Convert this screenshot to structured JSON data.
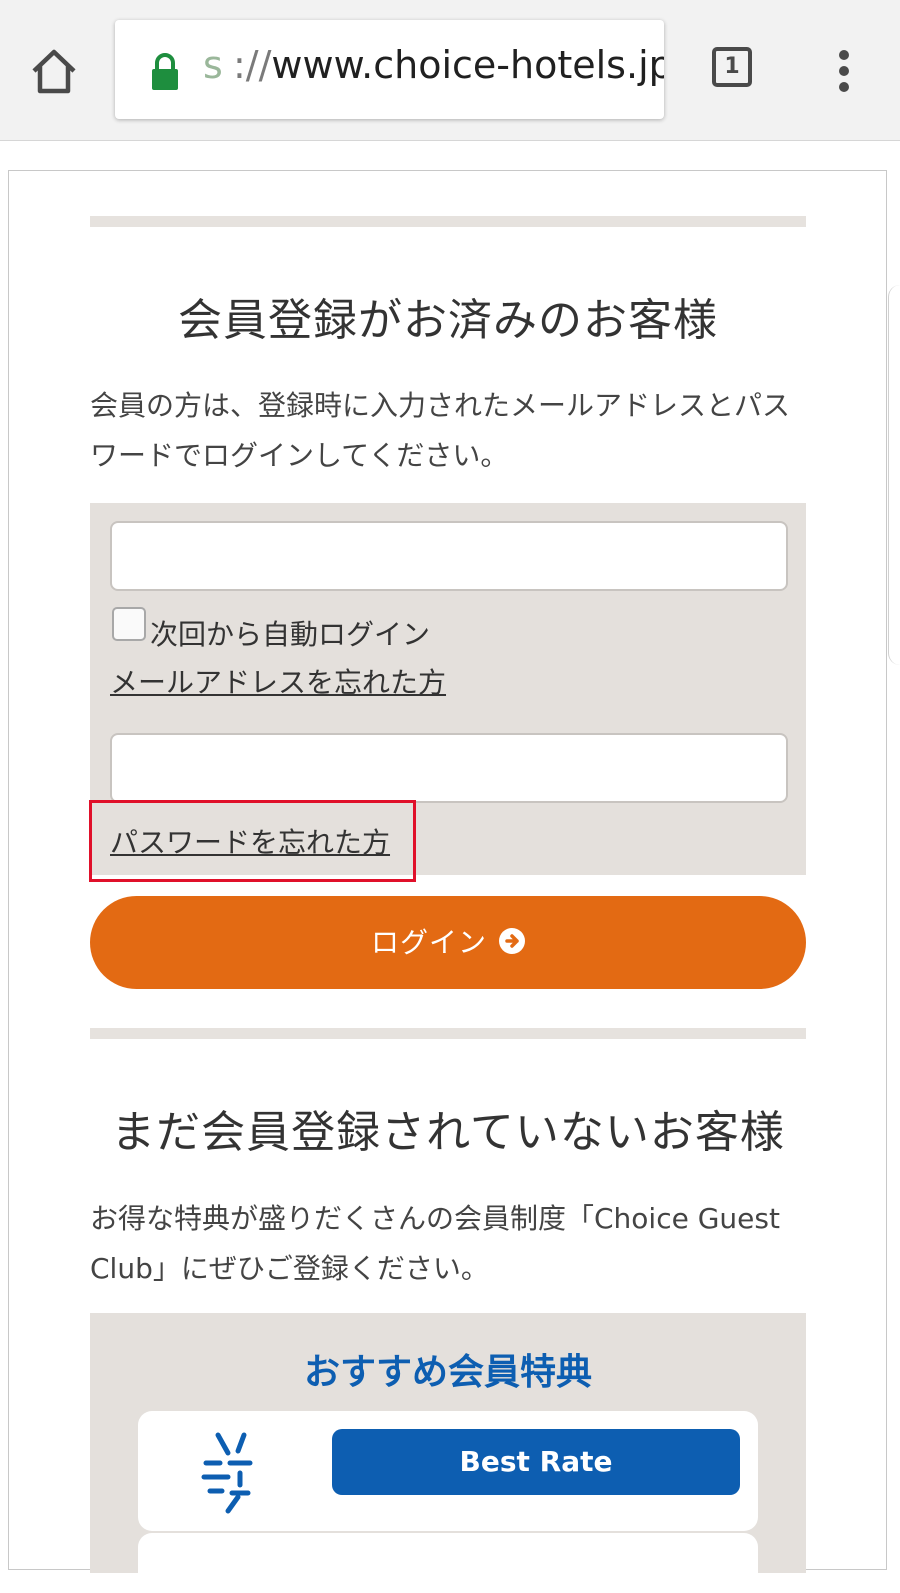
{
  "browser": {
    "url_faded": "s",
    "url_protocol": "://",
    "url_host": "www.choice-hotels.jp",
    "tab_count": "1"
  },
  "member_login": {
    "heading": "会員登録がお済みのお客様",
    "description": "会員の方は、登録時に入力されたメールアドレスとパスワードでログインしてください。",
    "email_value": "",
    "password_value": "",
    "auto_login_label": "次回から自動ログイン",
    "forgot_email_link": "メールアドレスを忘れた方",
    "forgot_password_link": "パスワードを忘れた方",
    "login_button": "ログイン"
  },
  "non_member": {
    "heading": "まだ会員登録されていないお客様",
    "description": "お得な特典が盛りだくさんの会員制度「Choice Guest Club」にぜひご登録ください。"
  },
  "benefits": {
    "title": "おすすめ会員特典",
    "items": [
      {
        "label": "Best Rate",
        "icon": "best-rate-icon"
      }
    ]
  },
  "colors": {
    "accent_orange": "#e36a13",
    "brand_blue": "#0d5eb1",
    "highlight_red": "#e0102a",
    "lock_green": "#1e8e3e"
  }
}
